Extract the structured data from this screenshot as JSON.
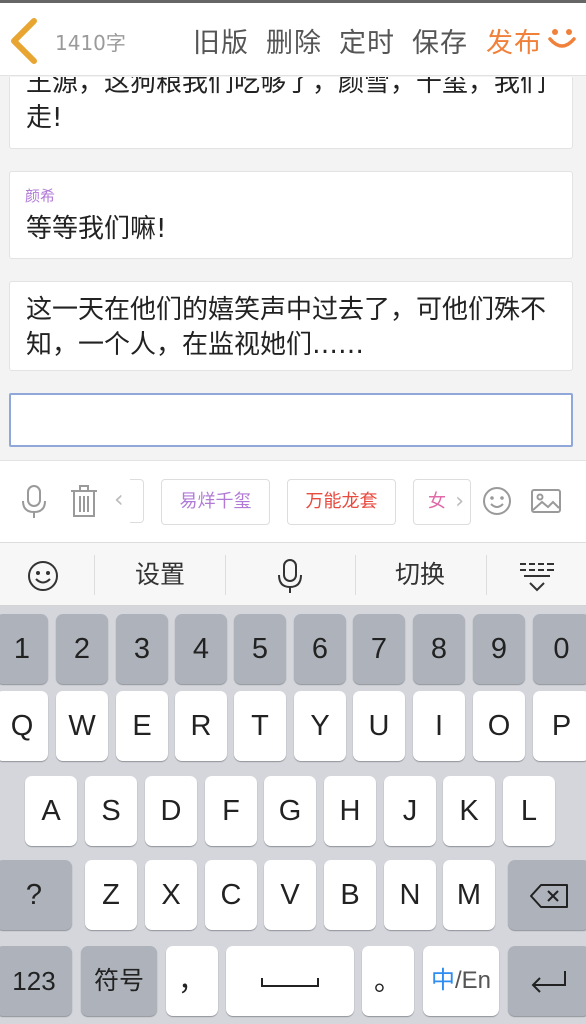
{
  "header": {
    "word_count": "1410字",
    "old_version": "旧版",
    "delete": "删除",
    "schedule": "定时",
    "save": "保存",
    "publish": "发布"
  },
  "messages": [
    {
      "text": "王源，这狗粮我们吃够了，颜雪，千玺，我们走!"
    },
    {
      "role": "颜希",
      "text": "等等我们嘛!"
    },
    {
      "text": "这一天在他们的嬉笑声中过去了，可他们殊不知，一个人，在监视她们……"
    }
  ],
  "input": {
    "value": ""
  },
  "toolbar": {
    "chips": [
      "易烊千玺",
      "万能龙套",
      "女"
    ]
  },
  "keyboard_top": {
    "settings": "设置",
    "switch": "切换"
  },
  "keyboard": {
    "numbers": [
      "1",
      "2",
      "3",
      "4",
      "5",
      "6",
      "7",
      "8",
      "9",
      "0"
    ],
    "row1": [
      "Q",
      "W",
      "E",
      "R",
      "T",
      "Y",
      "U",
      "I",
      "O",
      "P"
    ],
    "row2": [
      "A",
      "S",
      "D",
      "F",
      "G",
      "H",
      "J",
      "K",
      "L"
    ],
    "row3": [
      "Z",
      "X",
      "C",
      "V",
      "B",
      "N",
      "M"
    ],
    "question": "?",
    "mode_123": "123",
    "symbols": "符号",
    "comma": "，",
    "period": "。",
    "lang_zh": "中",
    "lang_en": "/En"
  },
  "colors": {
    "accent": "#f0803a",
    "role": "#b07ad6",
    "chip_red": "#e84a3d"
  }
}
